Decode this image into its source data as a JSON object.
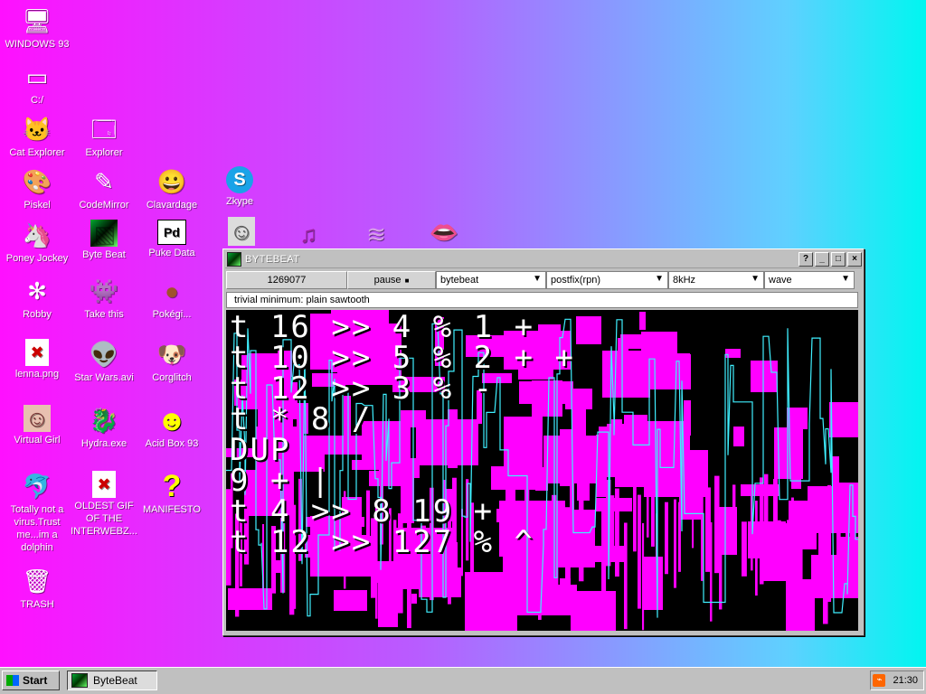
{
  "desktop_icons": [
    {
      "name": "windows-93",
      "label": "WINDOWS 93",
      "glyph": "🖥"
    },
    {
      "name": "c-drive",
      "label": "C:/",
      "glyph": "▭"
    },
    {
      "name": "cat-explorer",
      "label": "Cat Explorer",
      "glyph": "🐱"
    },
    {
      "name": "explorer",
      "label": "Explorer",
      "glyph": "🗔"
    },
    {
      "name": "piskel",
      "label": "Piskel",
      "glyph": "🎨"
    },
    {
      "name": "codemirror",
      "label": "CodeMirror",
      "glyph": "✎"
    },
    {
      "name": "clavardage",
      "label": "Clavardage",
      "glyph": "😀"
    },
    {
      "name": "zkype",
      "label": "Zkype",
      "glyph": "S"
    },
    {
      "name": "poney-jockey",
      "label": "Poney Jockey",
      "glyph": "🦄"
    },
    {
      "name": "byte-beat",
      "label": "Byte Beat",
      "glyph": "▧"
    },
    {
      "name": "puke-data",
      "label": "Puke Data",
      "glyph": "Pd"
    },
    {
      "name": "robby",
      "label": "Robby",
      "glyph": "✻"
    },
    {
      "name": "take-this",
      "label": "Take this",
      "glyph": "👾"
    },
    {
      "name": "pokegi",
      "label": "Pokégi...",
      "glyph": "●"
    },
    {
      "name": "lenna",
      "label": "lenna.png",
      "glyph": "✖"
    },
    {
      "name": "star-wars",
      "label": "Star Wars.avi",
      "glyph": "👽"
    },
    {
      "name": "corglitch",
      "label": "Corglitch",
      "glyph": "🐶"
    },
    {
      "name": "virtual-girl",
      "label": "Virtual Girl",
      "glyph": "☺"
    },
    {
      "name": "hydra",
      "label": "Hydra.exe",
      "glyph": "🐉"
    },
    {
      "name": "acid-box",
      "label": "Acid Box 93",
      "glyph": "☻"
    },
    {
      "name": "dolphin",
      "label": "Totally not a virus.Trust me...im a dolphin",
      "glyph": "🐬"
    },
    {
      "name": "oldest-gif",
      "label": "OLDEST GIF OF THE INTERWEBZ...",
      "glyph": "✖"
    },
    {
      "name": "manifesto",
      "label": "MANIFESTO",
      "glyph": "?"
    },
    {
      "name": "trash",
      "label": "TRASH",
      "glyph": "🗑"
    }
  ],
  "window": {
    "title": "BYTEBEAT",
    "help_btn": "?",
    "min_btn": "_",
    "max_btn": "□",
    "close_btn": "×",
    "counter": "1269077",
    "pause_label": "pause",
    "pause_glyph": "■",
    "mode_select": "bytebeat",
    "notation_select": "postfix(rpn)",
    "rate_select": "8kHz",
    "view_select": "wave",
    "arrow": "▼",
    "expression": "trivial minimum: plain sawtooth",
    "code": "t 16 >> 4 % 1 +\nt 10 >> 5 % 2 + +\nt 12 >> 3 % -\nt * 8 /\nDUP\n9 + |\nt 4 >> 8 19 +\nt 12 >> 127 % ^"
  },
  "taskbar": {
    "start_label": "Start",
    "task_label": "ByteBeat",
    "rss_glyph": "⌁",
    "clock": "21:30"
  },
  "colors": {
    "viz_magenta": "#ff00ff",
    "viz_cyan": "#3ff0ff",
    "viz_bg": "#000000"
  }
}
